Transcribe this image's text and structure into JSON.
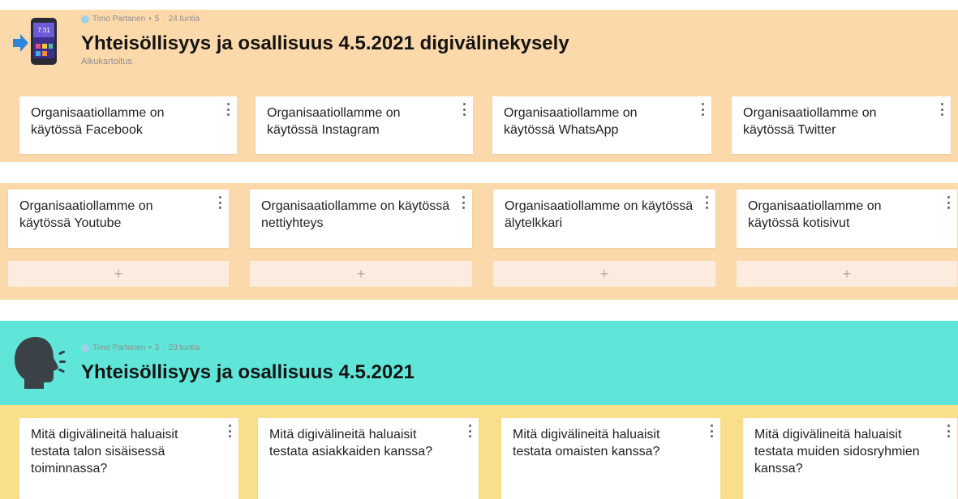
{
  "sections": [
    {
      "meta": {
        "author": "Timo Partanen",
        "sep1": "•",
        "count": "5",
        "sep2": "·",
        "time": "24 tuntia"
      },
      "title": "Yhteisöllisyys ja osallisuus 4.5.2021 digivälinekysely",
      "subtitle": "Alkukartoitus",
      "icon": "smartphone-arrow-icon",
      "color": "#fcd9ab",
      "cards": [
        "Organisaatiollamme on käytössä Facebook",
        "Organisaatiollamme on käytössä Instagram",
        "Organisaatiollamme on käytössä WhatsApp",
        "Organisaatiollamme on käytössä Twitter",
        "Organisaatiollamme on käytössä Youtube",
        "Organisaatiollamme on käytössä nettiyhteys",
        "Organisaatiollamme on käytössä älytelkkari",
        "Organisaatiollamme on käytössä kotisivut"
      ],
      "add_label": "+"
    },
    {
      "meta": {
        "author": "Timo Partanen",
        "sep1": "•",
        "count": "3",
        "sep2": "·",
        "time": "23 tuntia"
      },
      "title": "Yhteisöllisyys ja osallisuus 4.5.2021",
      "icon": "speaking-head-icon",
      "color": "#5fe6d8",
      "cards": [
        "Mitä digivälineitä haluaisit testata talon sisäisessä toiminnassa?",
        "Mitä digivälineitä haluaisit testata asiakkaiden kanssa?",
        "Mitä digivälineitä haluaisit testata omaisten kanssa?",
        "Mitä digivälineitä haluaisit testata muiden sidosryhmien kanssa?"
      ]
    }
  ]
}
